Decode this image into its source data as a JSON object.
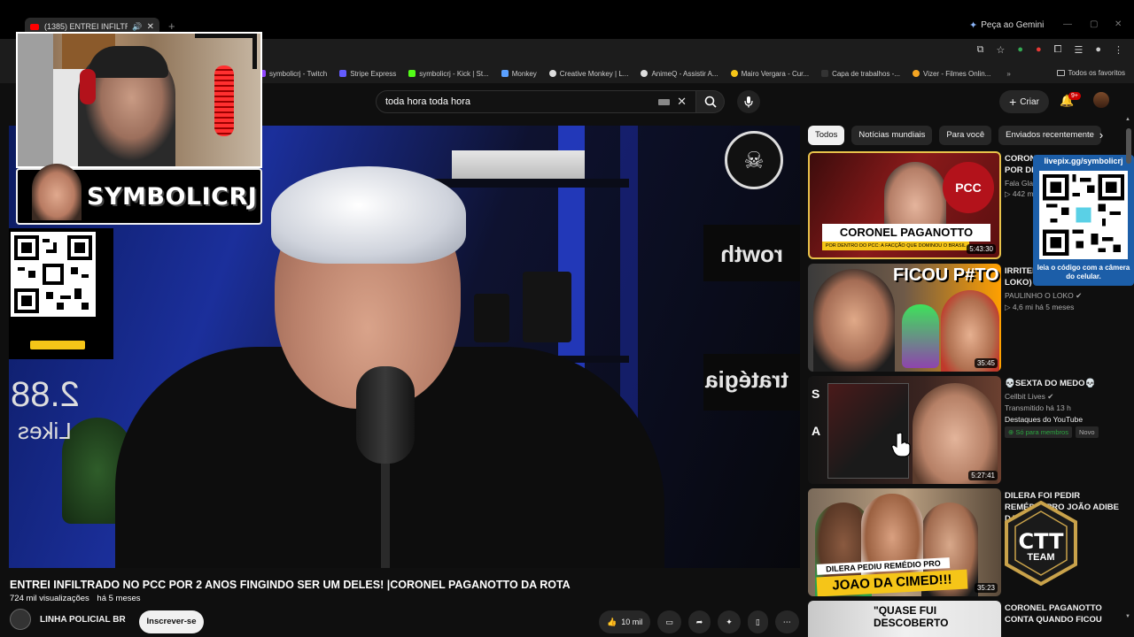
{
  "browser": {
    "tab_title": "(1385) ENTREI INFILTRADO",
    "gemini_label": "Peça ao Gemini",
    "bookmarks": [
      {
        "label": "symbolicrj - Twitch",
        "color": "#9146ff"
      },
      {
        "label": "Stripe Express",
        "color": "#635bff"
      },
      {
        "label": "symbolicrj - Kick | St...",
        "color": "#53fc18"
      },
      {
        "label": "Monkey",
        "color": "#5aa0ff"
      },
      {
        "label": "Creative Monkey | L...",
        "color": "#dddddd"
      },
      {
        "label": "AnimeQ - Assistir A...",
        "color": "#dddddd"
      },
      {
        "label": "Mairo Vergara - Cur...",
        "color": "#f5c518"
      },
      {
        "label": "Capa de trabalhos -...",
        "color": "#333333"
      },
      {
        "label": "Vizer - Filmes Onlin...",
        "color": "#f5a623"
      }
    ],
    "bookmarks_more": "»",
    "all_bookmarks": "Todos os favoritos"
  },
  "header": {
    "search_query": "toda hora toda hora",
    "create_label": "Criar",
    "notif_count": "9+"
  },
  "player": {
    "likes_number": "2.88",
    "likes_word": "Likes",
    "sign1": "rowth",
    "sign2": "tratégia"
  },
  "overlay": {
    "streamer_name": "SYMBOLICRJ",
    "qr_url": "livepix.gg/symbolicrj",
    "qr_hint": "leia o código com a câmera do celular.",
    "team_label": "TEAM"
  },
  "video": {
    "title": "ENTREI INFILTRADO NO PCC POR 2 ANOS FINGINDO SER UM DELES! |CORONEL PAGANOTTO DA ROTA",
    "views": "724 mil visualizações",
    "age": "há 5 meses",
    "channel": "LINHA POLICIAL BR",
    "subscribe": "Inscrever-se",
    "likes": "10 mil"
  },
  "chips": [
    "Todos",
    "Notícias mundiais",
    "Para você",
    "Enviados recentemente"
  ],
  "related": [
    {
      "title": "CORONEL PAGANOTTO POR DENTRO DO F4CÇÃO",
      "channel": "Fala Glau",
      "stats": "442 mil",
      "duration": "5:43:30",
      "thumb_text": "CORONEL PAGANOTTO",
      "thumb_sub": "POR DENTRO DO PCC: A FACÇÃO QUE DOMINOU O BRASIL",
      "thumb_badge": "PCC"
    },
    {
      "title": "IRRITEI ao VIVO (Paulinho o LOKO)",
      "channel": "PAULINHO O LOKO",
      "stats": "4,6 mi",
      "age": "há 5 meses",
      "duration": "35:45",
      "thumb_text": "FICOU P#TO"
    },
    {
      "title": "💀SEXTA DO MEDO💀",
      "channel": "Cellbit Lives",
      "stats": "Transmitido há 13 h",
      "extra": "Destaques do YouTube",
      "badge_members": "Só para membros",
      "badge_new": "Novo",
      "duration": "5:27:41",
      "thumb_text": "S",
      "thumb_text2": "A"
    },
    {
      "title": "DILERA FOI PEDIR REMÉDIO PRO JOÃO ADIBE DA CIMED",
      "duration": "35:23",
      "thumb_text": "DILERA PEDIU REMÉDIO PRO",
      "thumb_text2": "JOAO DA CIMED!!!"
    },
    {
      "title": "CORONEL PAGANOTTO CONTA QUANDO FICOU",
      "thumb_text": "\"QUASE FUI DESCOBERTO"
    }
  ]
}
